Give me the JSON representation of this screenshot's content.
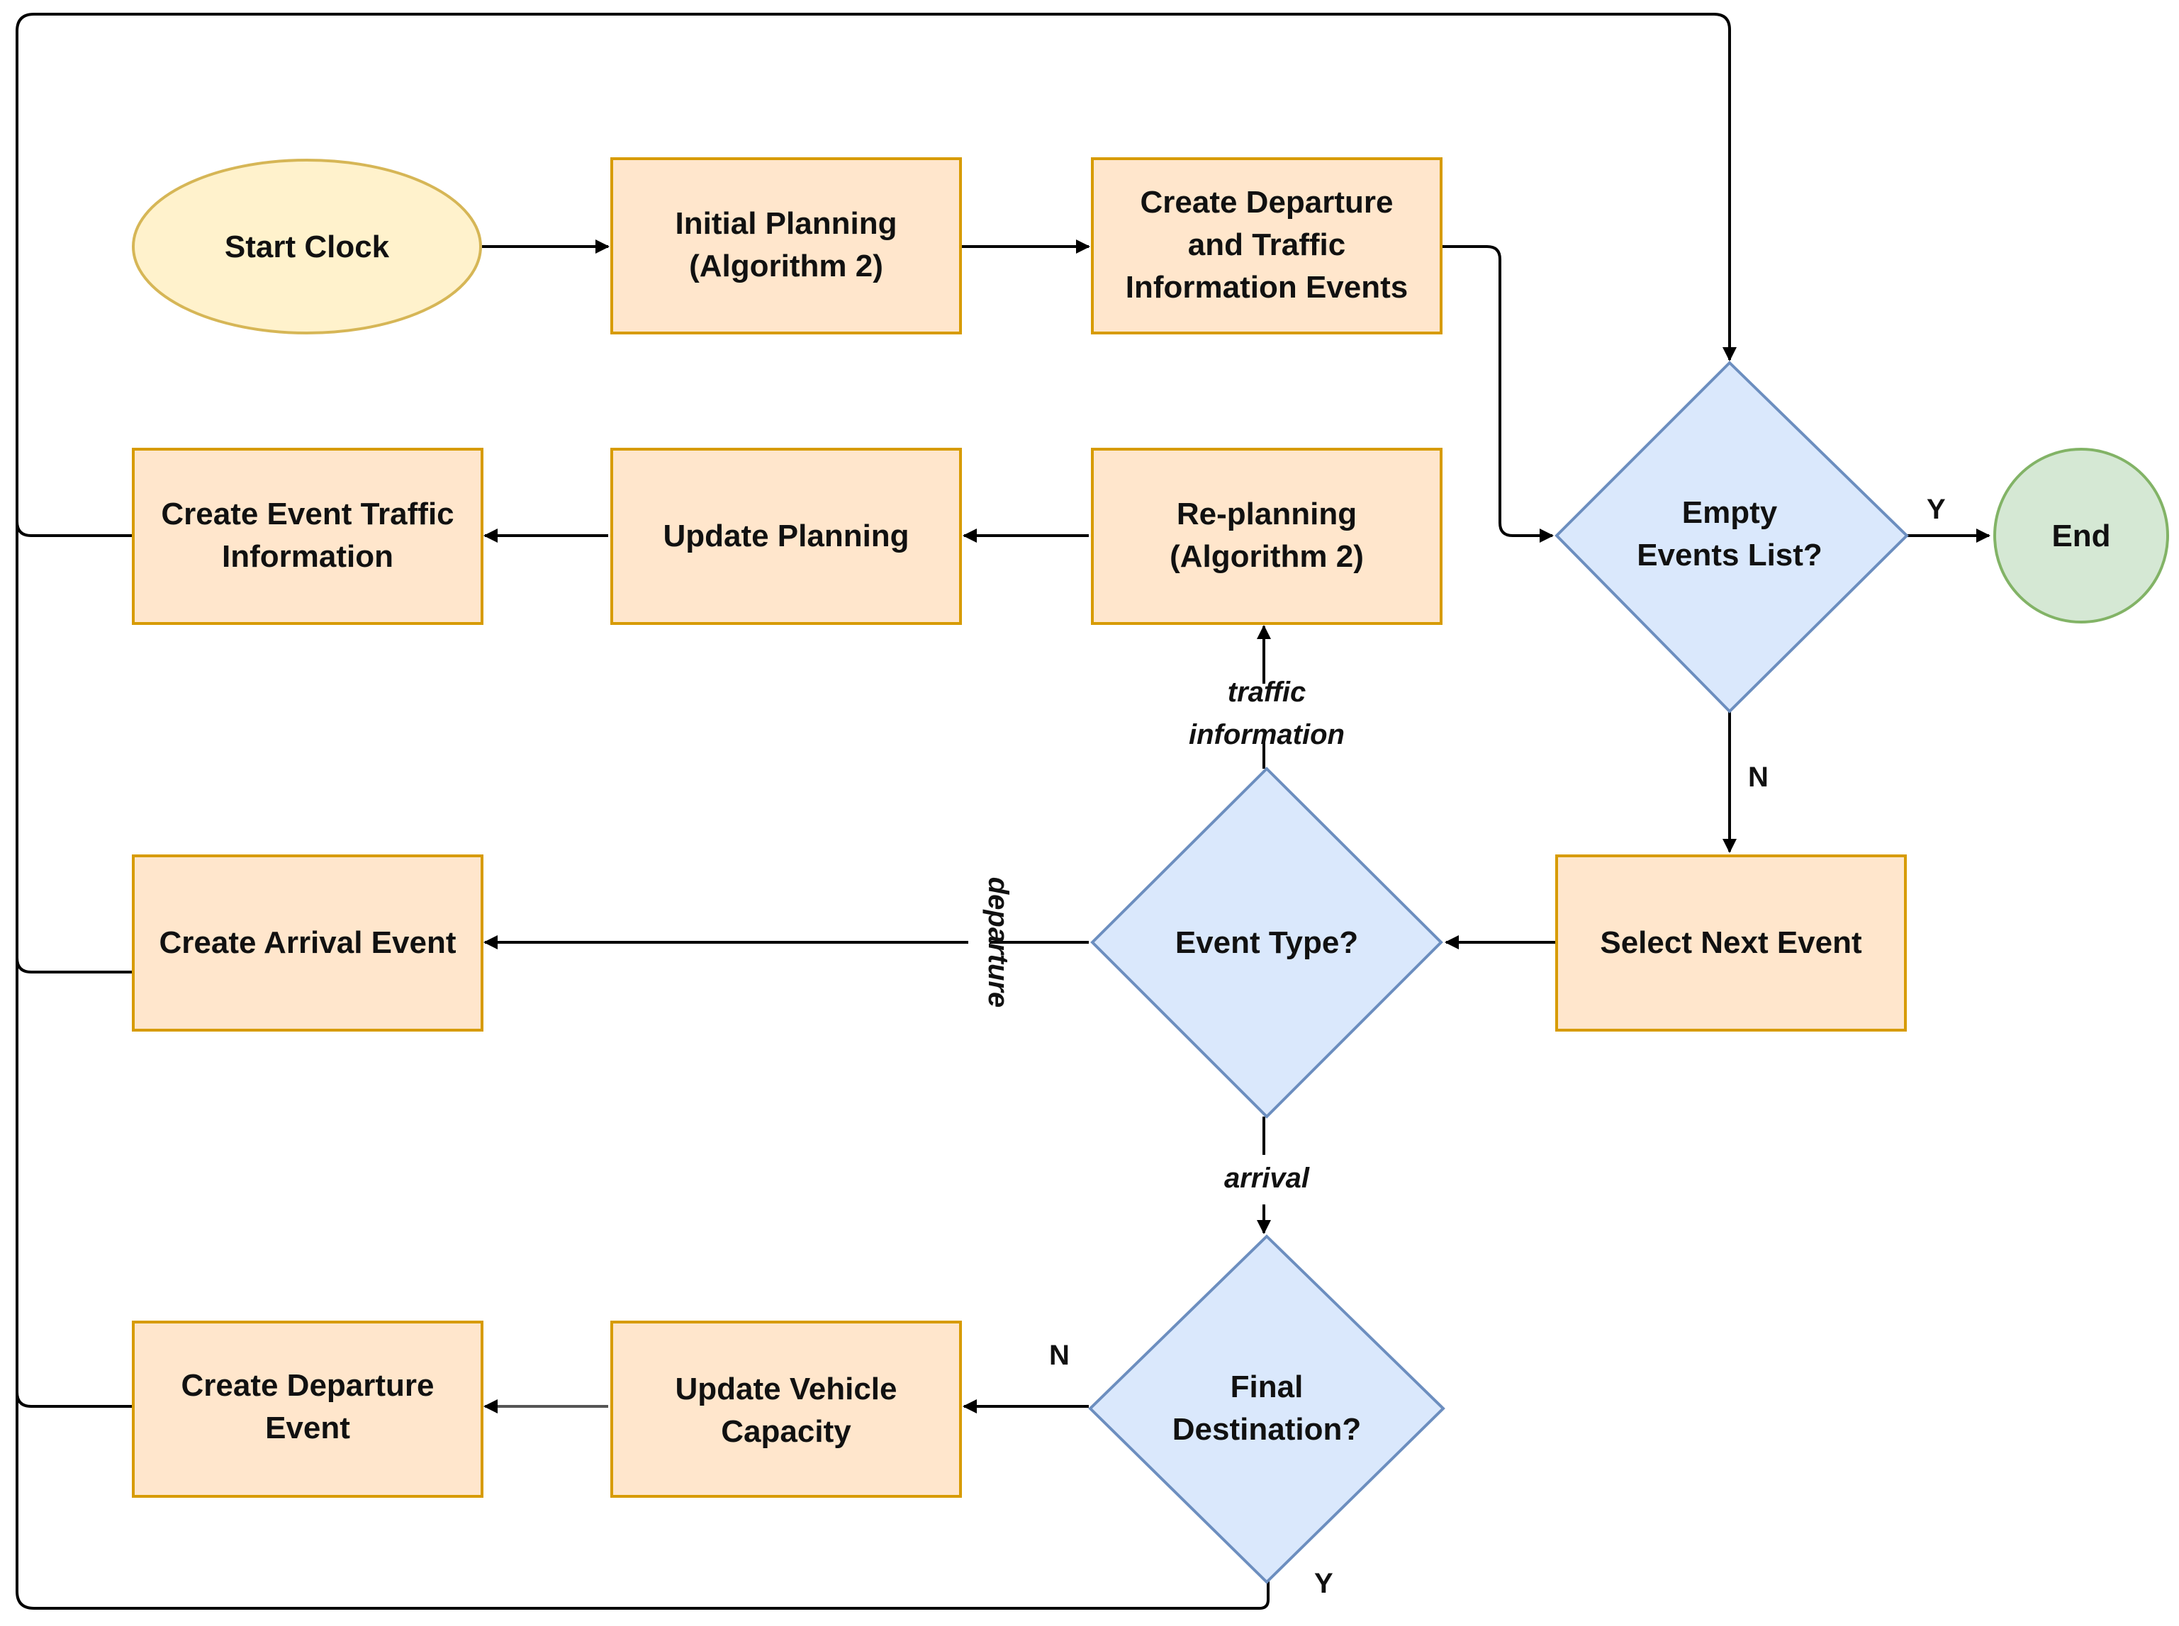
{
  "diagram": {
    "type": "flowchart",
    "colors": {
      "process_fill": "#FFE6CC",
      "process_stroke": "#D79B00",
      "start_fill": "#FFF2CC",
      "start_stroke": "#D6B656",
      "decision_fill": "#DAE8FC",
      "decision_stroke": "#6C8EBF",
      "end_fill": "#D5E8D4",
      "end_stroke": "#82B366"
    },
    "nodes": {
      "start": {
        "lines": [
          "Start Clock"
        ]
      },
      "initial_planning": {
        "lines": [
          "Initial Planning",
          "(Algorithm 2)"
        ]
      },
      "create_departure_traffic": {
        "lines": [
          "Create Departure",
          "and Traffic",
          "Information Events"
        ]
      },
      "empty_events": {
        "lines": [
          "Empty",
          "Events List?"
        ]
      },
      "end": {
        "lines": [
          "End"
        ]
      },
      "replanning": {
        "lines": [
          "Re-planning",
          "(Algorithm 2)"
        ]
      },
      "update_planning": {
        "lines": [
          "Update Planning"
        ]
      },
      "create_event_traffic": {
        "lines": [
          "Create Event Traffic",
          "Information"
        ]
      },
      "select_next": {
        "lines": [
          "Select Next Event"
        ]
      },
      "event_type": {
        "lines": [
          "Event Type?"
        ]
      },
      "create_arrival": {
        "lines": [
          "Create Arrival Event"
        ]
      },
      "final_destination": {
        "lines": [
          "Final",
          "Destination?"
        ]
      },
      "update_vehicle": {
        "lines": [
          "Update Vehicle",
          "Capacity"
        ]
      },
      "create_departure": {
        "lines": [
          "Create Departure",
          "Event"
        ]
      }
    },
    "edge_labels": {
      "empty_yes": "Y",
      "empty_no": "N",
      "traffic": [
        "traffic",
        "information"
      ],
      "departure": "departure",
      "arrival": "arrival",
      "final_no": "N",
      "final_yes": "Y"
    }
  }
}
